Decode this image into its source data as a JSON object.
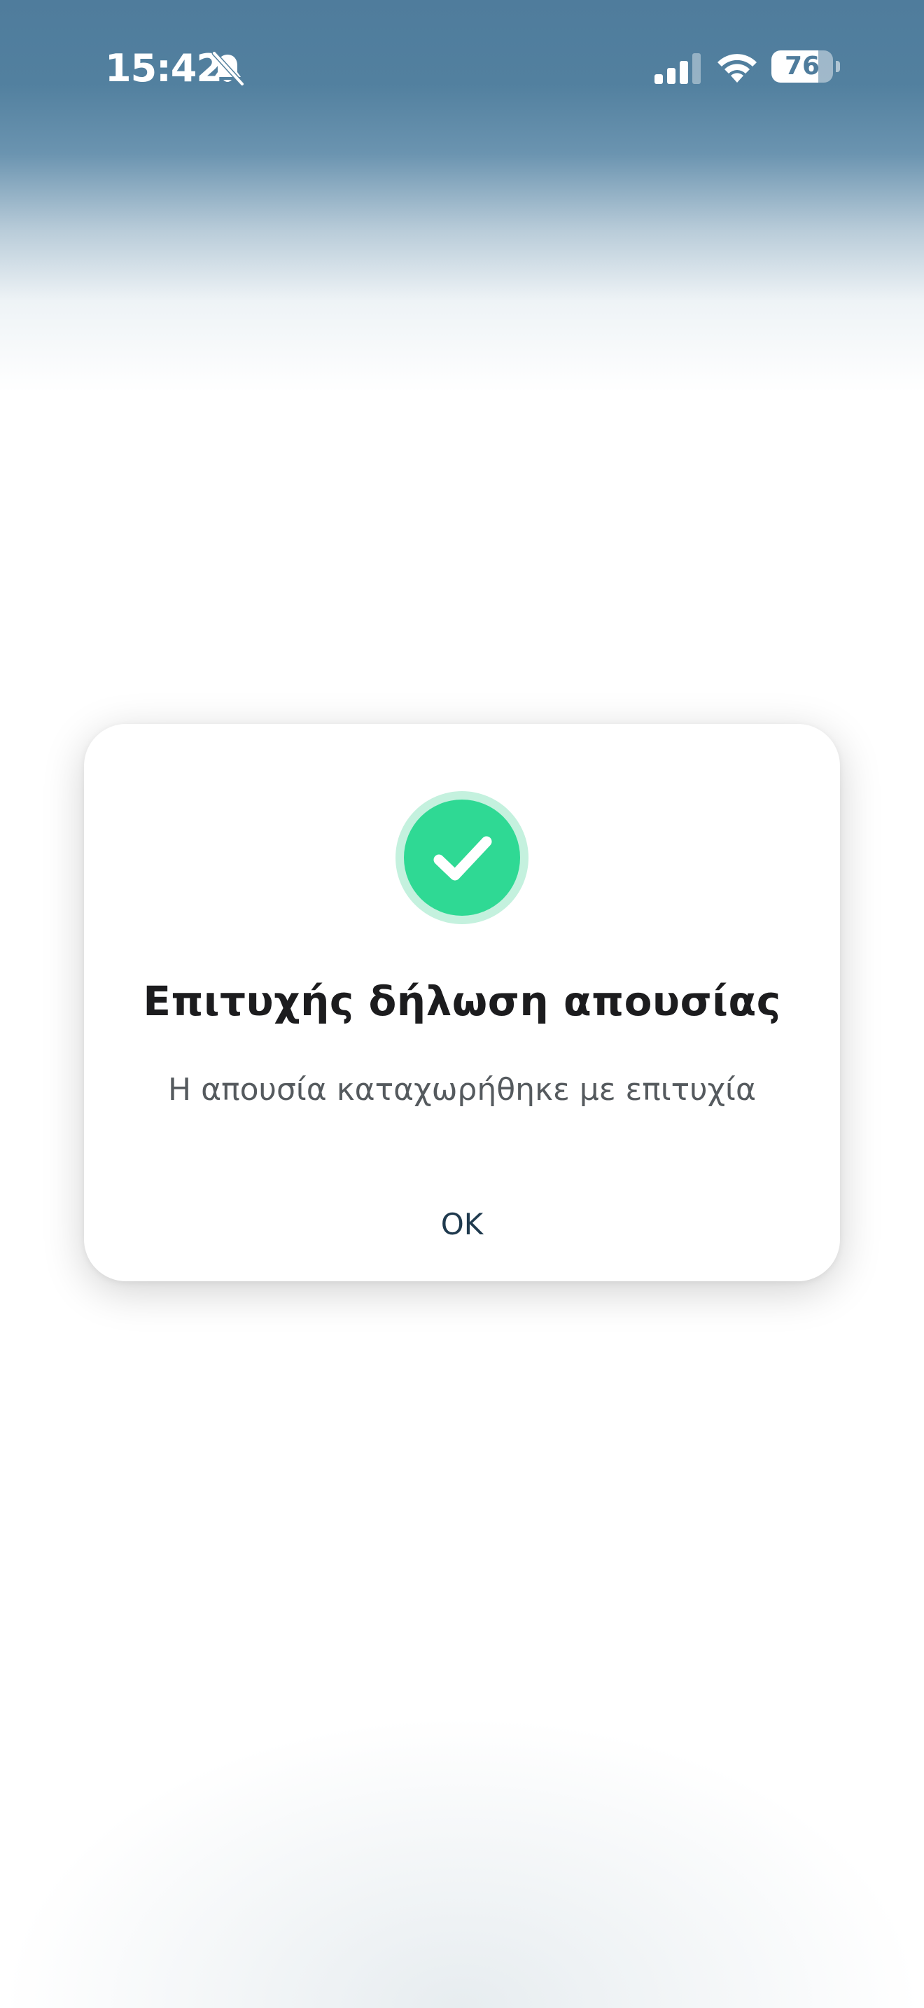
{
  "status_bar": {
    "time": "15:42",
    "battery_level": 76,
    "battery_text": "76",
    "icons": [
      "bell-slash-icon",
      "cellular-signal-icon",
      "wifi-icon",
      "battery-icon"
    ]
  },
  "dialog": {
    "icon": "check-circle-icon",
    "title": "Επιτυχής δήλωση απουσίας",
    "message": "Η απουσία καταχωρήθηκε με επιτυχία",
    "ok_label": "OK"
  },
  "colors": {
    "header_background": "#4f7c9c",
    "success_green": "#2fd994",
    "success_halo": "#c4f1de",
    "title_text": "#1c1c1e",
    "message_text": "#555a5e",
    "button_text": "#1f3a4e"
  }
}
